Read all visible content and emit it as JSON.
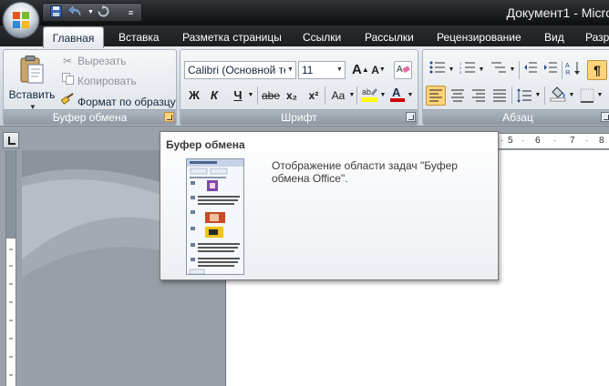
{
  "window": {
    "title": "Документ1 - Micro"
  },
  "tabs": [
    {
      "label": "Главная",
      "active": true
    },
    {
      "label": "Вставка"
    },
    {
      "label": "Разметка страницы"
    },
    {
      "label": "Ссылки"
    },
    {
      "label": "Рассылки"
    },
    {
      "label": "Рецензирование"
    },
    {
      "label": "Вид"
    },
    {
      "label": "Разр"
    }
  ],
  "clipboard": {
    "paste": "Вставить",
    "cut": "Вырезать",
    "copy": "Копировать",
    "format_painter": "Формат по образцу",
    "group_label": "Буфер обмена"
  },
  "font": {
    "name": "Calibri (Основной те",
    "size": "11",
    "group_label": "Шрифт",
    "bold": "Ж",
    "italic": "К",
    "underline": "Ч",
    "strikethrough": "abe",
    "subscript": "x₂",
    "superscript": "x²",
    "change_case": "Aa",
    "grow": "A",
    "shrink": "A"
  },
  "paragraph": {
    "group_label": "Абзац"
  },
  "ruler": {
    "numbers": [
      "5",
      "6",
      "7",
      "8"
    ]
  },
  "tooltip": {
    "title": "Буфер обмена",
    "description": "Отображение области задач \"Буфер обмена Office\"."
  },
  "colors": {
    "highlight": "#ffff00",
    "font_color": "#d00000",
    "launcher_hover": "#ffd47a"
  }
}
